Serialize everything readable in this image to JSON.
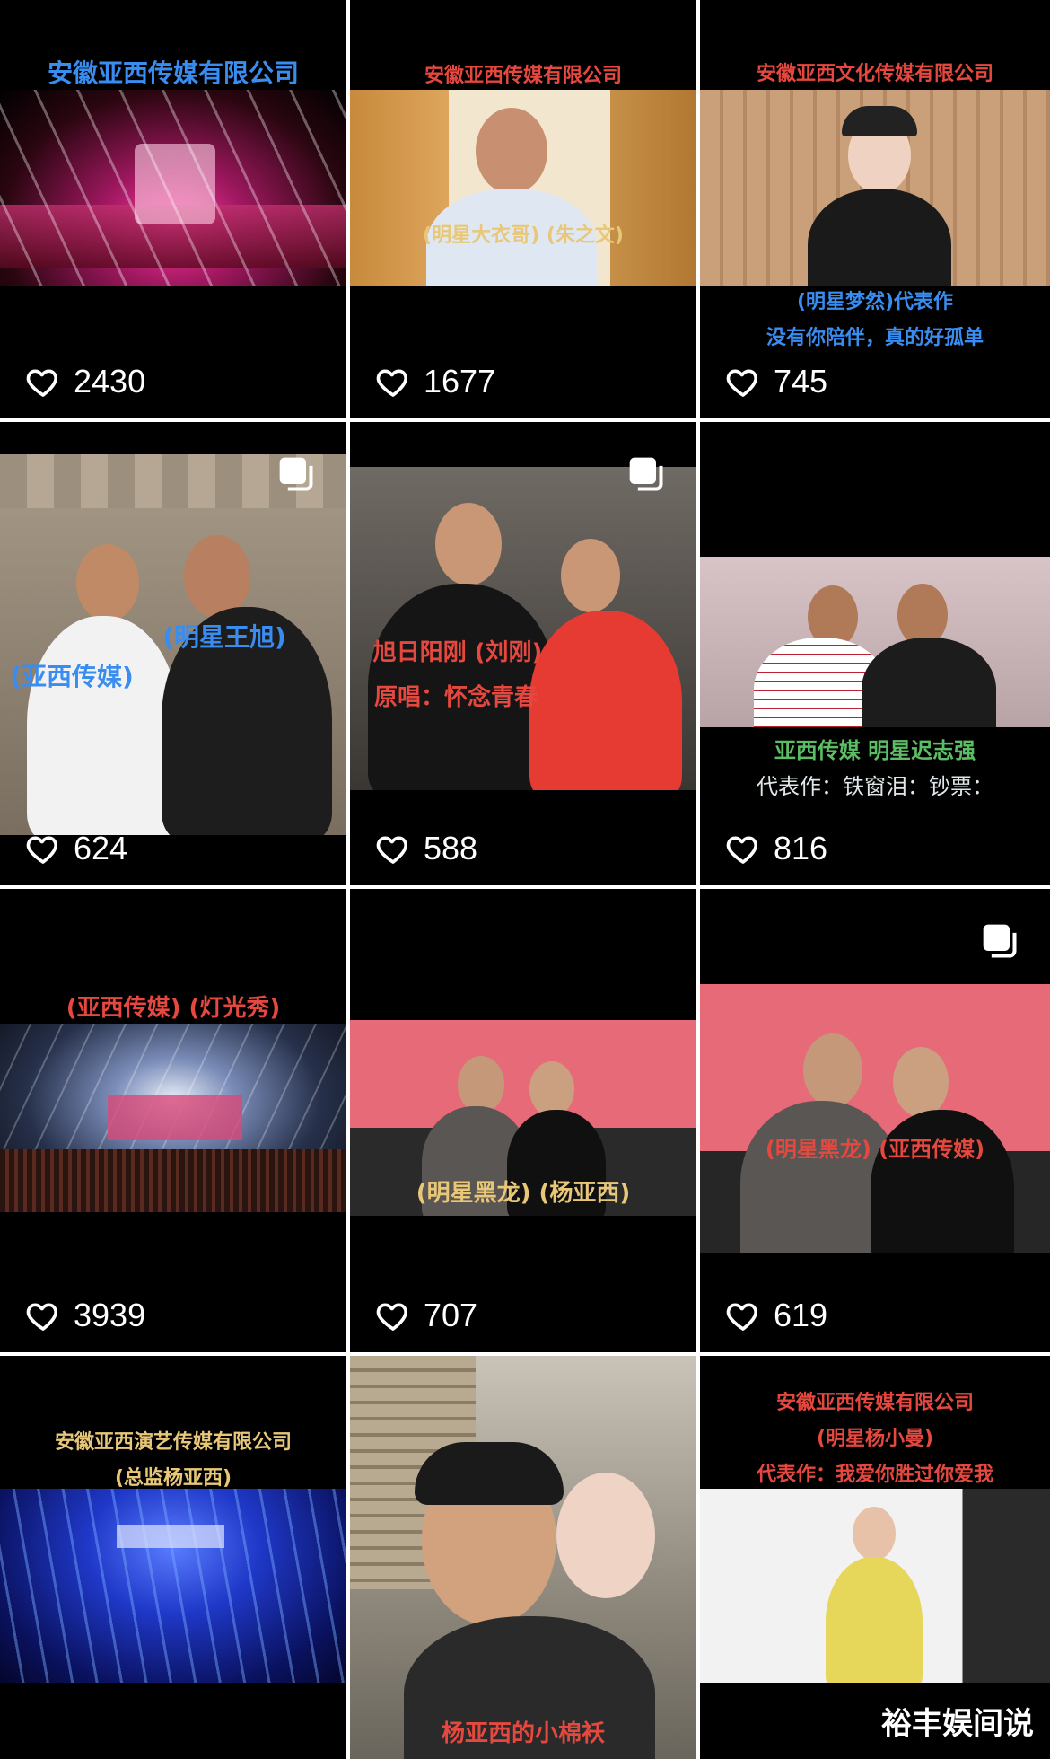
{
  "tiles": [
    {
      "caption_top": "安徽亚西传媒有限公司",
      "caption_mid": "",
      "caption_mid2": "",
      "likes": "2430"
    },
    {
      "caption_top": "安徽亚西传媒有限公司",
      "caption_mid": "(明星大衣哥) (朱之文)",
      "caption_mid2": "",
      "likes": "1677"
    },
    {
      "caption_top": "安徽亚西文化传媒有限公司",
      "caption_mid": "(明星梦然)代表作",
      "caption_mid2": "没有你陪伴，真的好孤单",
      "likes": "745"
    },
    {
      "caption_top": "(明星王旭)",
      "caption_mid": "(亚西传媒)",
      "caption_mid2": "",
      "likes": "624"
    },
    {
      "caption_top": "旭日阳刚 (刘刚)",
      "caption_mid": "原唱：怀念青春",
      "caption_mid2": "",
      "likes": "588"
    },
    {
      "caption_top": "亚西传媒  明星迟志强",
      "caption_mid": "代表作：铁窗泪：钞票：",
      "caption_mid2": "",
      "likes": "816"
    },
    {
      "caption_top": "(亚西传媒)  (灯光秀)",
      "caption_mid": "",
      "caption_mid2": "",
      "likes": "3939"
    },
    {
      "caption_top": "(明星黑龙)  (杨亚西)",
      "caption_mid": "",
      "caption_mid2": "",
      "likes": "707"
    },
    {
      "caption_top": "(明星黑龙)  (亚西传媒)",
      "caption_mid": "",
      "caption_mid2": "",
      "likes": "619"
    },
    {
      "caption_top": "安徽亚西演艺传媒有限公司",
      "caption_mid": "(总监杨亚西)",
      "caption_mid2": "",
      "likes": ""
    },
    {
      "caption_top": "杨亚西的小棉袄",
      "caption_mid": "",
      "caption_mid2": "",
      "likes": ""
    },
    {
      "caption_top": "安徽亚西传媒有限公司",
      "caption_mid": "(明星杨小曼)",
      "caption_mid2": "代表作：我爱你胜过你爱我",
      "likes": ""
    }
  ],
  "watermark": "裕丰娱间说",
  "icons": {
    "like": "heart-outline-icon",
    "multi": "multiple-photos-icon"
  },
  "colors": {
    "background": "#000000",
    "divider": "#ffffff",
    "text": "#ffffff"
  }
}
